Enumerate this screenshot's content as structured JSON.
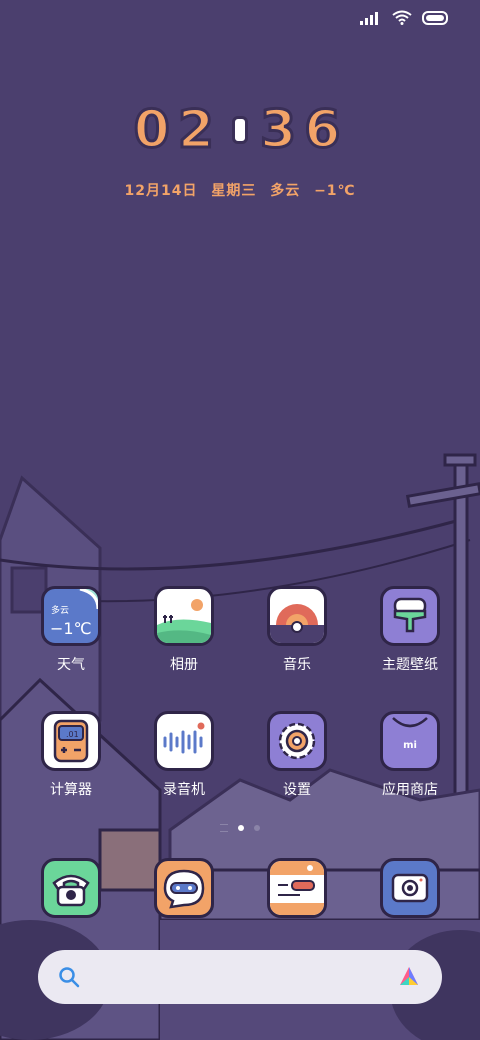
{
  "status_bar": {
    "signal_icon": "signal-icon",
    "wifi_icon": "wifi-icon",
    "battery_icon": "battery-icon"
  },
  "clock": {
    "hour_tens": "0",
    "hour_ones": "2",
    "minute_tens": "3",
    "minute_ones": "6"
  },
  "date": {
    "day": "12月14日",
    "weekday": "星期三",
    "weather": "多云",
    "temperature": "−1℃"
  },
  "apps_row1": [
    {
      "label": "天气",
      "icon": "weather-icon",
      "widget_weather": "多云",
      "widget_temp": "−1℃"
    },
    {
      "label": "相册",
      "icon": "gallery-icon"
    },
    {
      "label": "音乐",
      "icon": "music-icon"
    },
    {
      "label": "主题壁纸",
      "icon": "themes-icon"
    }
  ],
  "apps_row2": [
    {
      "label": "计算器",
      "icon": "calculator-icon",
      "display": ".01"
    },
    {
      "label": "录音机",
      "icon": "recorder-icon"
    },
    {
      "label": "设置",
      "icon": "settings-icon"
    },
    {
      "label": "应用商店",
      "icon": "app-store-icon",
      "store_mark": "mi"
    }
  ],
  "dock": [
    {
      "icon": "phone-icon"
    },
    {
      "icon": "messages-icon"
    },
    {
      "icon": "browser-icon"
    },
    {
      "icon": "camera-icon"
    }
  ],
  "pager": {
    "current_page": 1,
    "total_pages": 2
  },
  "search": {
    "icon": "search-icon",
    "assistant_icon": "assistant-icon"
  },
  "colors": {
    "background": "#4b3f6e",
    "accent": "#f2a368",
    "outline": "#2f2548"
  }
}
